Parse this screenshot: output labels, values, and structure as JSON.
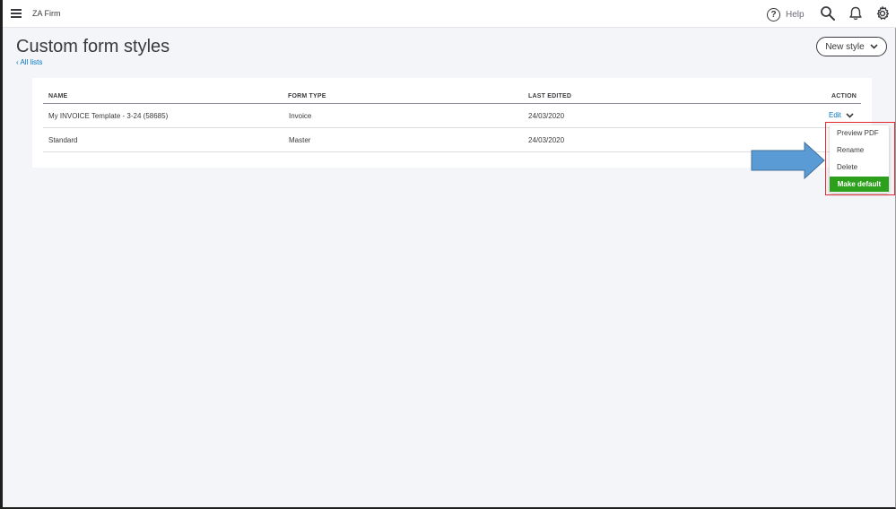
{
  "topbar": {
    "menu_icon": "hamburger-icon",
    "company_name": "ZA Firm",
    "help_label": "Help",
    "icons": [
      "help-icon",
      "search-icon",
      "bell-icon",
      "gear-icon"
    ]
  },
  "page": {
    "title": "Custom form styles",
    "back_link": "All lists",
    "new_style_label": "New style"
  },
  "table": {
    "columns": [
      "NAME",
      "FORM TYPE",
      "LAST EDITED",
      "ACTION"
    ],
    "rows": [
      {
        "name": "My INVOICE Template - 3-24 (58685)",
        "form_type": "Invoice",
        "last_edited": "24/03/2020",
        "action": "Edit"
      },
      {
        "name": "Standard",
        "form_type": "Master",
        "last_edited": "24/03/2020",
        "action": ""
      }
    ]
  },
  "action_menu": {
    "items": [
      "Preview PDF",
      "Rename",
      "Delete"
    ],
    "primary": "Make default"
  },
  "colors": {
    "link": "#0077c5",
    "primary_green": "#2ca01c",
    "highlight_red": "#e0282e",
    "arrow_blue": "#5b9bd5"
  }
}
